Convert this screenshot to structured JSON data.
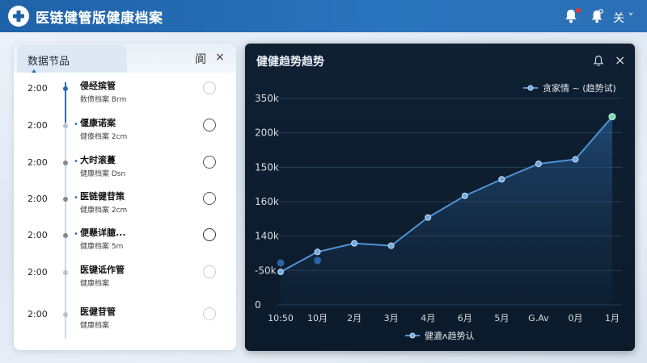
{
  "app": {
    "title": "医链健管版健康档案",
    "user_menu": "关 ˅"
  },
  "colors": {
    "header_bg": "#2368ae",
    "accent": "#2a6cb0",
    "chart_bg": "#0f2033",
    "series_line": "#4f93d6",
    "notification_dot": "#e33333"
  },
  "header_icons": [
    "bell-icon",
    "settings-bell-icon"
  ],
  "left_panel": {
    "title": "数据节品",
    "action_label": "阆",
    "close_label": "×",
    "items": [
      {
        "time": "2:00",
        "title": "侵经摈管",
        "subtitle": "数偾档案 Brm",
        "bullet": "",
        "checked_style": "light"
      },
      {
        "time": "2:00",
        "title": "偃康诺案",
        "subtitle": "健傣档案 2cm",
        "bullet": "•",
        "checked_style": "dark"
      },
      {
        "time": "2:00",
        "title": "大时滚蔓",
        "subtitle": "健康档案 Dsn",
        "bullet": "•",
        "checked_style": "dark"
      },
      {
        "time": "2:00",
        "title": "医链健苷策",
        "subtitle": "健康档案 2cm",
        "bullet": "•",
        "checked_style": "dark"
      },
      {
        "time": "2:00",
        "title": "便懸详臆...",
        "subtitle": "健康档案 5m",
        "bullet": "•",
        "checked_style": "dark"
      },
      {
        "time": "2:00",
        "title": "医键诋作管",
        "subtitle": "健康档案",
        "bullet": "",
        "checked_style": "light"
      },
      {
        "time": "2:00",
        "title": "医健苷管",
        "subtitle": "健康档案",
        "bullet": "",
        "checked_style": "light"
      }
    ]
  },
  "right_panel": {
    "title": "健健趋势趋势",
    "bell_icon": "🔔",
    "close_label": "×"
  },
  "chart_data": {
    "type": "line",
    "title": "健健趋势趋势",
    "x_categories": [
      "10:50",
      "10月",
      "2月",
      "3月",
      "4月",
      "6月",
      "5月",
      "G.Av",
      "0月",
      "1月"
    ],
    "y_tick_labels": [
      "0",
      "-50k",
      "140k",
      "160k",
      "150k",
      "200k",
      "350k"
    ],
    "legend_top": "贪家情 ~ (趋势试)",
    "legend_bottom": "健漉ʌ趋势认",
    "legend_top_position": "top-right",
    "legend_bottom_position": "bottom-center",
    "series": [
      {
        "values": [
          0.96,
          1.54,
          1.79,
          1.72,
          2.54,
          3.17,
          3.65,
          4.1,
          4.23,
          5.47
        ],
        "note": "values expressed in gridline units (0 = baseline, 6 = top line)"
      }
    ],
    "secondary_points": [
      {
        "x_index": 0,
        "y": 1.22
      },
      {
        "x_index": 1,
        "y": 1.29
      }
    ],
    "grid": true
  }
}
